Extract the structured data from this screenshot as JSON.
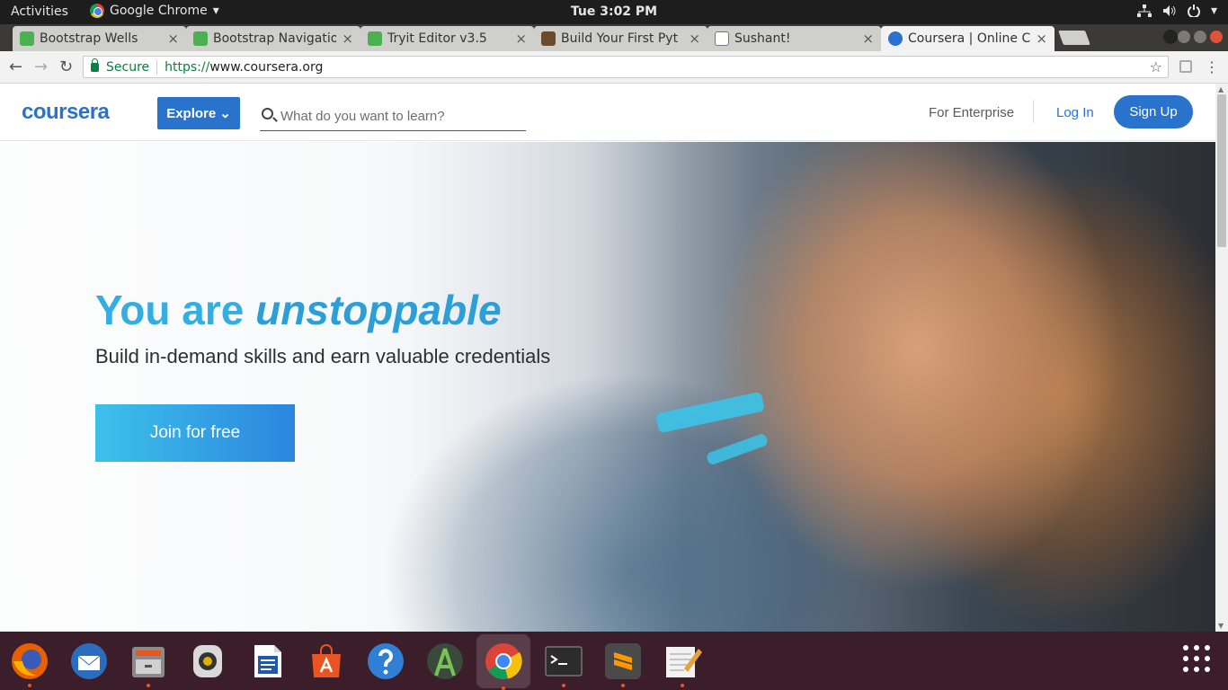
{
  "topbar": {
    "activities": "Activities",
    "app_name": "Google Chrome",
    "app_menu_arrow": "▾",
    "clock": "Tue  3:02 PM",
    "icons": [
      "network-icon",
      "volume-icon",
      "power-icon"
    ],
    "arrow": "▾"
  },
  "tabs": [
    {
      "label": "Bootstrap Wells",
      "favicon": "w3schools-icon",
      "active": false
    },
    {
      "label": "Bootstrap Navigatio",
      "favicon": "w3schools-icon",
      "active": false
    },
    {
      "label": "Tryit Editor v3.5",
      "favicon": "w3schools-icon",
      "active": false
    },
    {
      "label": "Build Your First Pyt",
      "favicon": "robot-icon",
      "active": false
    },
    {
      "label": "Sushant!",
      "favicon": "page-icon",
      "active": false
    },
    {
      "label": "Coursera | Online C",
      "favicon": "coursera-icon",
      "active": true
    }
  ],
  "toolbar": {
    "back": "←",
    "forward": "→",
    "reload": "↻",
    "secure_label": "Secure",
    "url_scheme": "https://",
    "url_host": "www.coursera.org",
    "star": "☆",
    "menu": "⋮",
    "close": "×"
  },
  "site": {
    "logo": "coursera",
    "explore_label": "Explore",
    "explore_chevron": "⌄",
    "search_placeholder": "What do you want to learn?",
    "enterprise": "For Enterprise",
    "login": "Log In",
    "signup": "Sign Up"
  },
  "hero": {
    "title_plain": "You are ",
    "title_emphasis": "unstoppable",
    "subtitle": "Build in-demand skills and earn valuable credentials",
    "cta": "Join for free"
  },
  "scrollbar": {
    "up": "▲",
    "down": "▼"
  },
  "dock": {
    "items": [
      {
        "name": "firefox-icon",
        "color": "#e66000",
        "running": true
      },
      {
        "name": "thunderbird-icon",
        "color": "#2a6dbf",
        "running": false
      },
      {
        "name": "files-icon",
        "color": "#8a8a8a",
        "running": true
      },
      {
        "name": "rhythmbox-icon",
        "color": "#d9d9d9",
        "running": false
      },
      {
        "name": "writer-icon",
        "color": "#1e5aa8",
        "running": false
      },
      {
        "name": "software-center-icon",
        "color": "#e95420",
        "running": false
      },
      {
        "name": "help-icon",
        "color": "#2f7fd4",
        "running": false
      },
      {
        "name": "android-studio-icon",
        "color": "#78c257",
        "running": false
      },
      {
        "name": "chrome-icon",
        "color": "#4285f4",
        "running": true
      },
      {
        "name": "terminal-icon",
        "color": "#2c2c2c",
        "running": true
      },
      {
        "name": "sublime-text-icon",
        "color": "#ff9800",
        "running": true
      },
      {
        "name": "text-editor-icon",
        "color": "#f2f2f2",
        "running": true
      }
    ]
  }
}
